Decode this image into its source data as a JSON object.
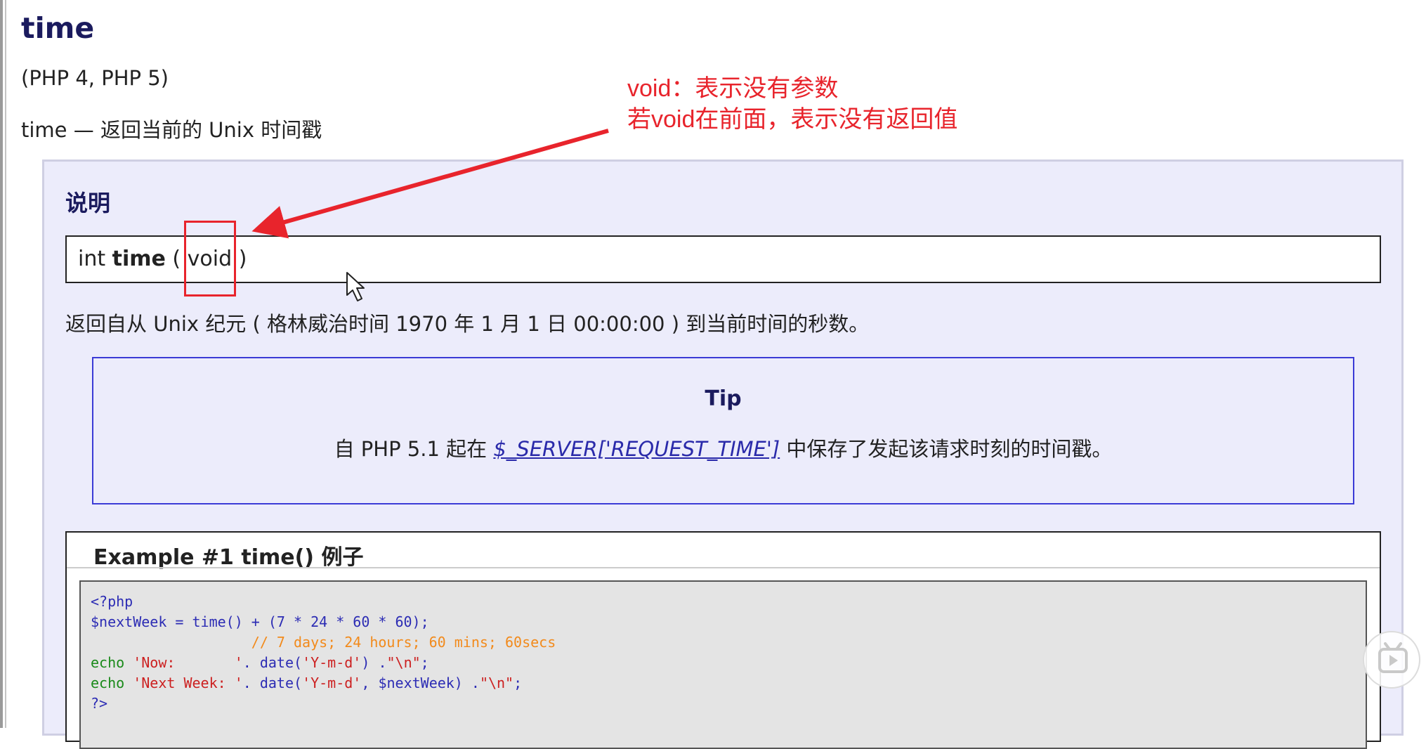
{
  "doc": {
    "title": "time",
    "versions": "(PHP 4, PHP 5)",
    "purpose": "time — 返回当前的 Unix 时间戳",
    "description_heading": "说明",
    "signature": {
      "return_type": "int ",
      "function_name": "time",
      "open": " ( ",
      "param": "void",
      "close": " )"
    },
    "returns": "返回自从 Unix 纪元 ( 格林威治时间 1970 年 1 月 1 日 00:00:00 ) 到当前时间的秒数。",
    "tip": {
      "title": "Tip",
      "text_before": "自 PHP 5.1 起在 ",
      "link_text": "$_SERVER['REQUEST_TIME']",
      "text_after": " 中保存了发起该请求时刻的时间戳。"
    },
    "example": {
      "title": "Example #1 time() 例子",
      "code": {
        "l1": "<?php",
        "l2": "$nextWeek = time() + (7 * 24 * 60 * 60);",
        "l3": "                   // 7 days; 24 hours; 60 mins; 60secs",
        "l4_kw": "echo ",
        "l4_str": "'Now:       '",
        "l4_rest": ". date(",
        "l4_str2": "'Y-m-d'",
        "l4_rest2": ") .",
        "l4_str3": "\"\\n\"",
        "l4_end": ";",
        "l5_kw": "echo ",
        "l5_str": "'Next Week: '",
        "l5_rest": ". date(",
        "l5_str2": "'Y-m-d'",
        "l5_rest2": ", $nextWeek) .",
        "l5_str3": "\"\\n\"",
        "l5_end": ";",
        "l6": "?>"
      }
    }
  },
  "annotation": {
    "line1": "void：表示没有参数",
    "line2": "若void在前面，表示没有返回值",
    "color": "#e8242c"
  },
  "colors": {
    "heading": "#1b1b5e",
    "description_bg": "#ececfb",
    "tip_border": "#3b3bd6",
    "link": "#2a2aaa",
    "code_bg": "#e4e4e4",
    "code_comment": "#f28a1b",
    "code_string": "#cc2020",
    "code_keyword": "#1a8a1a"
  },
  "icons": {
    "cursor": "mouse-cursor-icon",
    "player": "play-icon"
  }
}
